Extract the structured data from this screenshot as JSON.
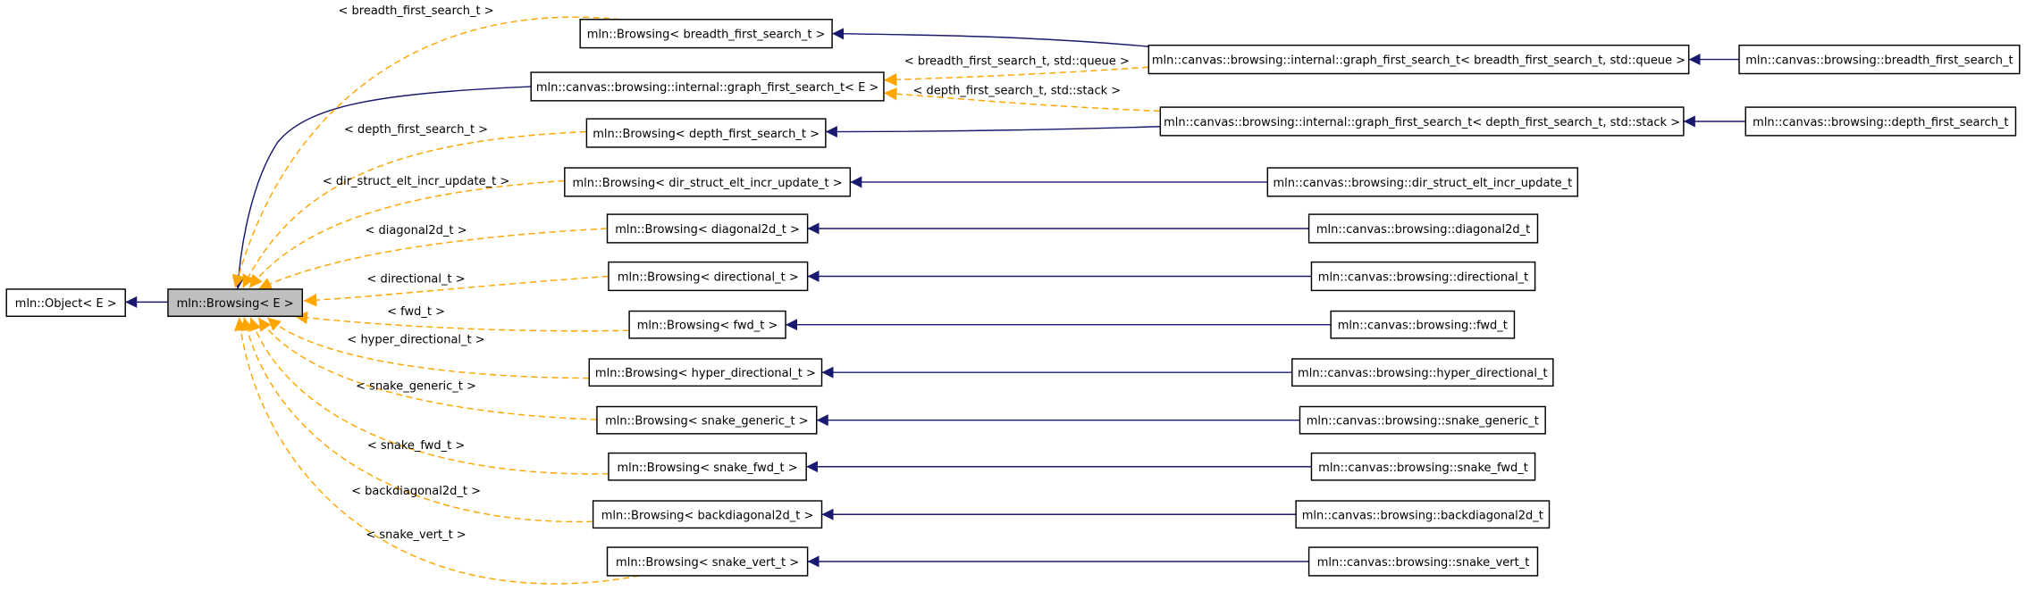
{
  "colors": {
    "inherit_edge": "#191970",
    "template_edge": "#ffa500",
    "focus_fill": "#bfbfbf",
    "node_fill": "#ffffff"
  },
  "nodes": [
    {
      "id": "object",
      "label": "mln::Object< E >"
    },
    {
      "id": "browsing",
      "label": "mln::Browsing< E >",
      "focus": true
    },
    {
      "id": "b_bfs",
      "label": "mln::Browsing< breadth_first_search_t >"
    },
    {
      "id": "gfs",
      "label": "mln::canvas::browsing::internal::graph_first_search_t< E >"
    },
    {
      "id": "b_dfs",
      "label": "mln::Browsing< depth_first_search_t >"
    },
    {
      "id": "b_dir",
      "label": "mln::Browsing< dir_struct_elt_incr_update_t >"
    },
    {
      "id": "b_diag",
      "label": "mln::Browsing< diagonal2d_t >"
    },
    {
      "id": "b_directional",
      "label": "mln::Browsing< directional_t >"
    },
    {
      "id": "b_fwd",
      "label": "mln::Browsing< fwd_t >"
    },
    {
      "id": "b_hyper",
      "label": "mln::Browsing< hyper_directional_t >"
    },
    {
      "id": "b_sgen",
      "label": "mln::Browsing< snake_generic_t >"
    },
    {
      "id": "b_sfwd",
      "label": "mln::Browsing< snake_fwd_t >"
    },
    {
      "id": "b_bdiag",
      "label": "mln::Browsing< backdiagonal2d_t >"
    },
    {
      "id": "b_svert",
      "label": "mln::Browsing< snake_vert_t >"
    },
    {
      "id": "gfs_bfs",
      "label": "mln::canvas::browsing::internal::graph_first_search_t< breadth_first_search_t, std::queue >"
    },
    {
      "id": "c_bfs",
      "label": "mln::canvas::browsing::breadth_first_search_t"
    },
    {
      "id": "gfs_dfs",
      "label": "mln::canvas::browsing::internal::graph_first_search_t< depth_first_search_t, std::stack >"
    },
    {
      "id": "c_dfs",
      "label": "mln::canvas::browsing::depth_first_search_t"
    },
    {
      "id": "c_dir",
      "label": "mln::canvas::browsing::dir_struct_elt_incr_update_t"
    },
    {
      "id": "c_diag",
      "label": "mln::canvas::browsing::diagonal2d_t"
    },
    {
      "id": "c_directional",
      "label": "mln::canvas::browsing::directional_t"
    },
    {
      "id": "c_fwd",
      "label": "mln::canvas::browsing::fwd_t"
    },
    {
      "id": "c_hyper",
      "label": "mln::canvas::browsing::hyper_directional_t"
    },
    {
      "id": "c_sgen",
      "label": "mln::canvas::browsing::snake_generic_t"
    },
    {
      "id": "c_sfwd",
      "label": "mln::canvas::browsing::snake_fwd_t"
    },
    {
      "id": "c_bdiag",
      "label": "mln::canvas::browsing::backdiagonal2d_t"
    },
    {
      "id": "c_svert",
      "label": "mln::canvas::browsing::snake_vert_t"
    }
  ],
  "edge_labels": [
    "< breadth_first_search_t >",
    "< depth_first_search_t >",
    "< dir_struct_elt_incr_update_t >",
    "< diagonal2d_t >",
    "< directional_t >",
    "< fwd_t >",
    "< hyper_directional_t >",
    "< snake_generic_t >",
    "< snake_fwd_t >",
    "< backdiagonal2d_t >",
    "< snake_vert_t >",
    "< breadth_first_search_t, std::queue >",
    "< depth_first_search_t, std::stack >"
  ]
}
